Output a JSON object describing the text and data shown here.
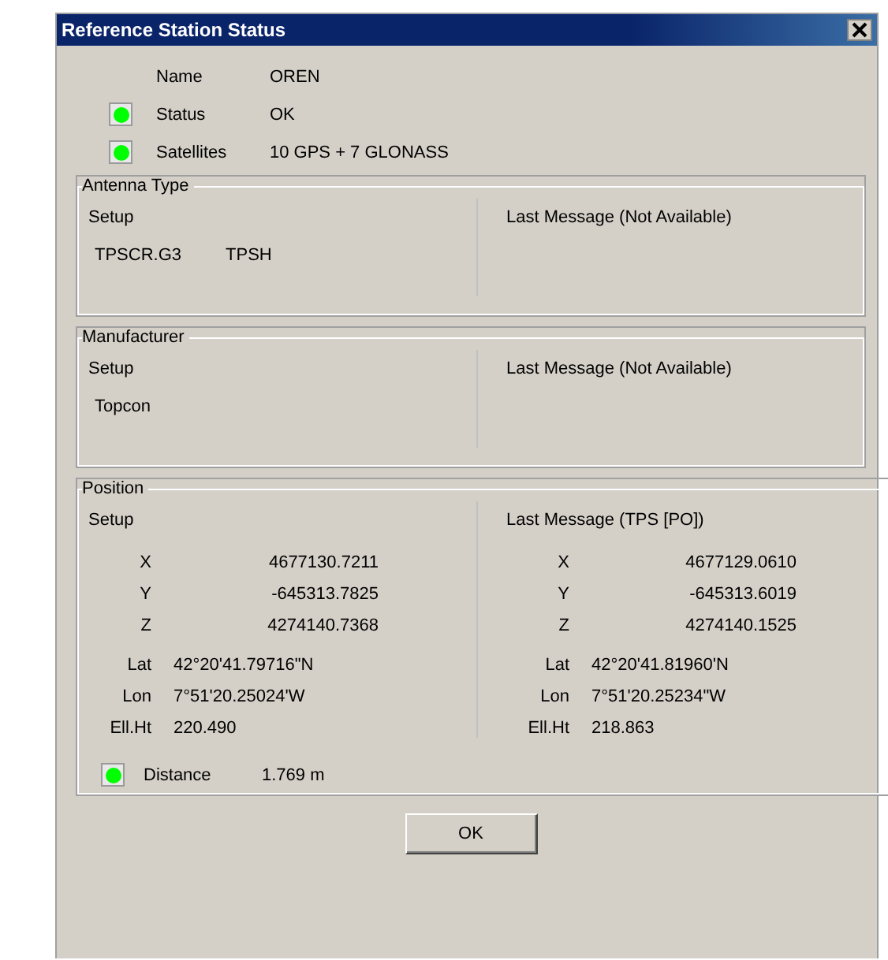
{
  "window": {
    "title": "Reference Station Status"
  },
  "summary": [
    {
      "label": "Name",
      "value": "OREN"
    },
    {
      "label": "Status",
      "value": "OK",
      "color": "#00ff00"
    },
    {
      "label": "Satellites",
      "value": "10 GPS + 7 GLONASS",
      "color": "#00ff00"
    }
  ],
  "antenna_type": {
    "title": "Antenna Type",
    "setup_label": "Setup",
    "setup_values": [
      "TPSCR.G3",
      "TPSH"
    ],
    "last_message_label": "Last Message (Not Available)"
  },
  "manufacturer": {
    "title": "Manufacturer",
    "setup_label": "Setup",
    "setup_values": [
      "Topcon"
    ],
    "last_message_label": "Last Message (Not Available)"
  },
  "position": {
    "title": "Position",
    "setup": {
      "label": "Setup",
      "rows": [
        {
          "kind": "coord",
          "label": "X",
          "value": "4677130.7211"
        },
        {
          "kind": "coord",
          "label": "Y",
          "value": "-645313.7825"
        },
        {
          "kind": "coord",
          "label": "Z",
          "value": "4274140.7368"
        },
        {
          "kind": "geo",
          "label": "Lat",
          "value": "42°20'41.79716\"N"
        },
        {
          "kind": "geo",
          "label": "Lon",
          "value": "7°51'20.25024'W"
        },
        {
          "kind": "geo",
          "label": "Ell.Ht",
          "value": "220.490"
        }
      ]
    },
    "last_message": {
      "label": "Last Message (TPS [PO])",
      "rows": [
        {
          "kind": "coord",
          "label": "X",
          "value": "4677129.0610"
        },
        {
          "kind": "coord",
          "label": "Y",
          "value": "-645313.6019"
        },
        {
          "kind": "coord",
          "label": "Z",
          "value": "4274140.1525"
        },
        {
          "kind": "geo",
          "label": "Lat",
          "value": "42°20'41.81960'N"
        },
        {
          "kind": "geo",
          "label": "Lon",
          "value": "7°51'20.25234\"W"
        },
        {
          "kind": "geo",
          "label": "Ell.Ht",
          "value": "218.863"
        }
      ]
    },
    "distance": {
      "label": "Distance",
      "value": "1.769 m",
      "color": "#00ff00"
    }
  },
  "buttons": [
    "OK"
  ]
}
